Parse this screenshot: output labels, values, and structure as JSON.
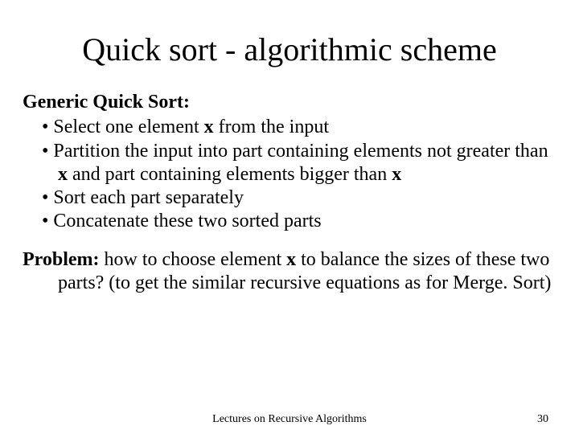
{
  "title": "Quick sort - algorithmic scheme",
  "subhead": "Generic Quick Sort:",
  "bullets": {
    "b1_pre": "Select one element ",
    "b1_bold": "x",
    "b1_post": " from the input",
    "b2_pre": "Partition the input into part containing elements not greater than ",
    "b2_bold1": "x",
    "b2_mid": " and part containing elements bigger than ",
    "b2_bold2": "x",
    "b3": "Sort each part separately",
    "b4": "Concatenate these two sorted parts"
  },
  "problem": {
    "label": "Problem:",
    "pre": " how to choose element ",
    "bold": "x",
    "post": " to balance the sizes of these two parts? (to get the similar recursive equations as for Merge. Sort)"
  },
  "footer": {
    "center": "Lectures on Recursive Algorithms",
    "page": "30"
  }
}
